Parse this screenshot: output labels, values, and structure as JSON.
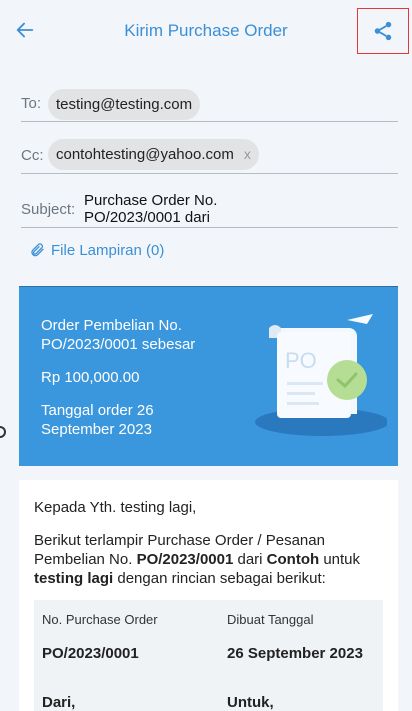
{
  "header": {
    "title": "Kirim Purchase Order"
  },
  "to": {
    "label": "To:",
    "chip": "testing@testing.com"
  },
  "cc": {
    "label": "Cc:",
    "chip": "contohtesting@yahoo.com",
    "remove": "x"
  },
  "subject": {
    "label": "Subject:",
    "line1": "Purchase Order No.",
    "line2": "PO/2023/0001 dari"
  },
  "attachment": {
    "label": "File Lampiran (0)"
  },
  "banner": {
    "line1": "Order Pembelian No.",
    "line2": "PO/2023/0001 sebesar",
    "amount": "Rp 100,000.00",
    "date1": "Tanggal order 26",
    "date2": "September 2023",
    "illustration_text": "PO"
  },
  "body": {
    "greeting": "Kepada Yth. testing lagi,",
    "p_start": "Berikut terlampir Purchase Order / Pesanan Pembelian No. ",
    "po_number": "PO/2023/0001",
    "p_mid1": " dari ",
    "company": "Contoh",
    "p_mid2": " untuk ",
    "recipient": "testing lagi",
    "p_end": " dengan rincian sebagai berikut:"
  },
  "details": {
    "col1_header": "No. Purchase Order",
    "col2_header": "Dibuat Tanggal",
    "col1_value": "PO/2023/0001",
    "col2_value": "26 September 2023",
    "from_label": "Dari,",
    "to_label": "Untuk,"
  },
  "colors": {
    "accent": "#3b8fd6",
    "banner": "#3b97dd",
    "highlight": "#e23a3a"
  },
  "icons": {
    "back": "arrow-left-icon",
    "share": "share-icon",
    "attach": "paperclip-icon"
  }
}
